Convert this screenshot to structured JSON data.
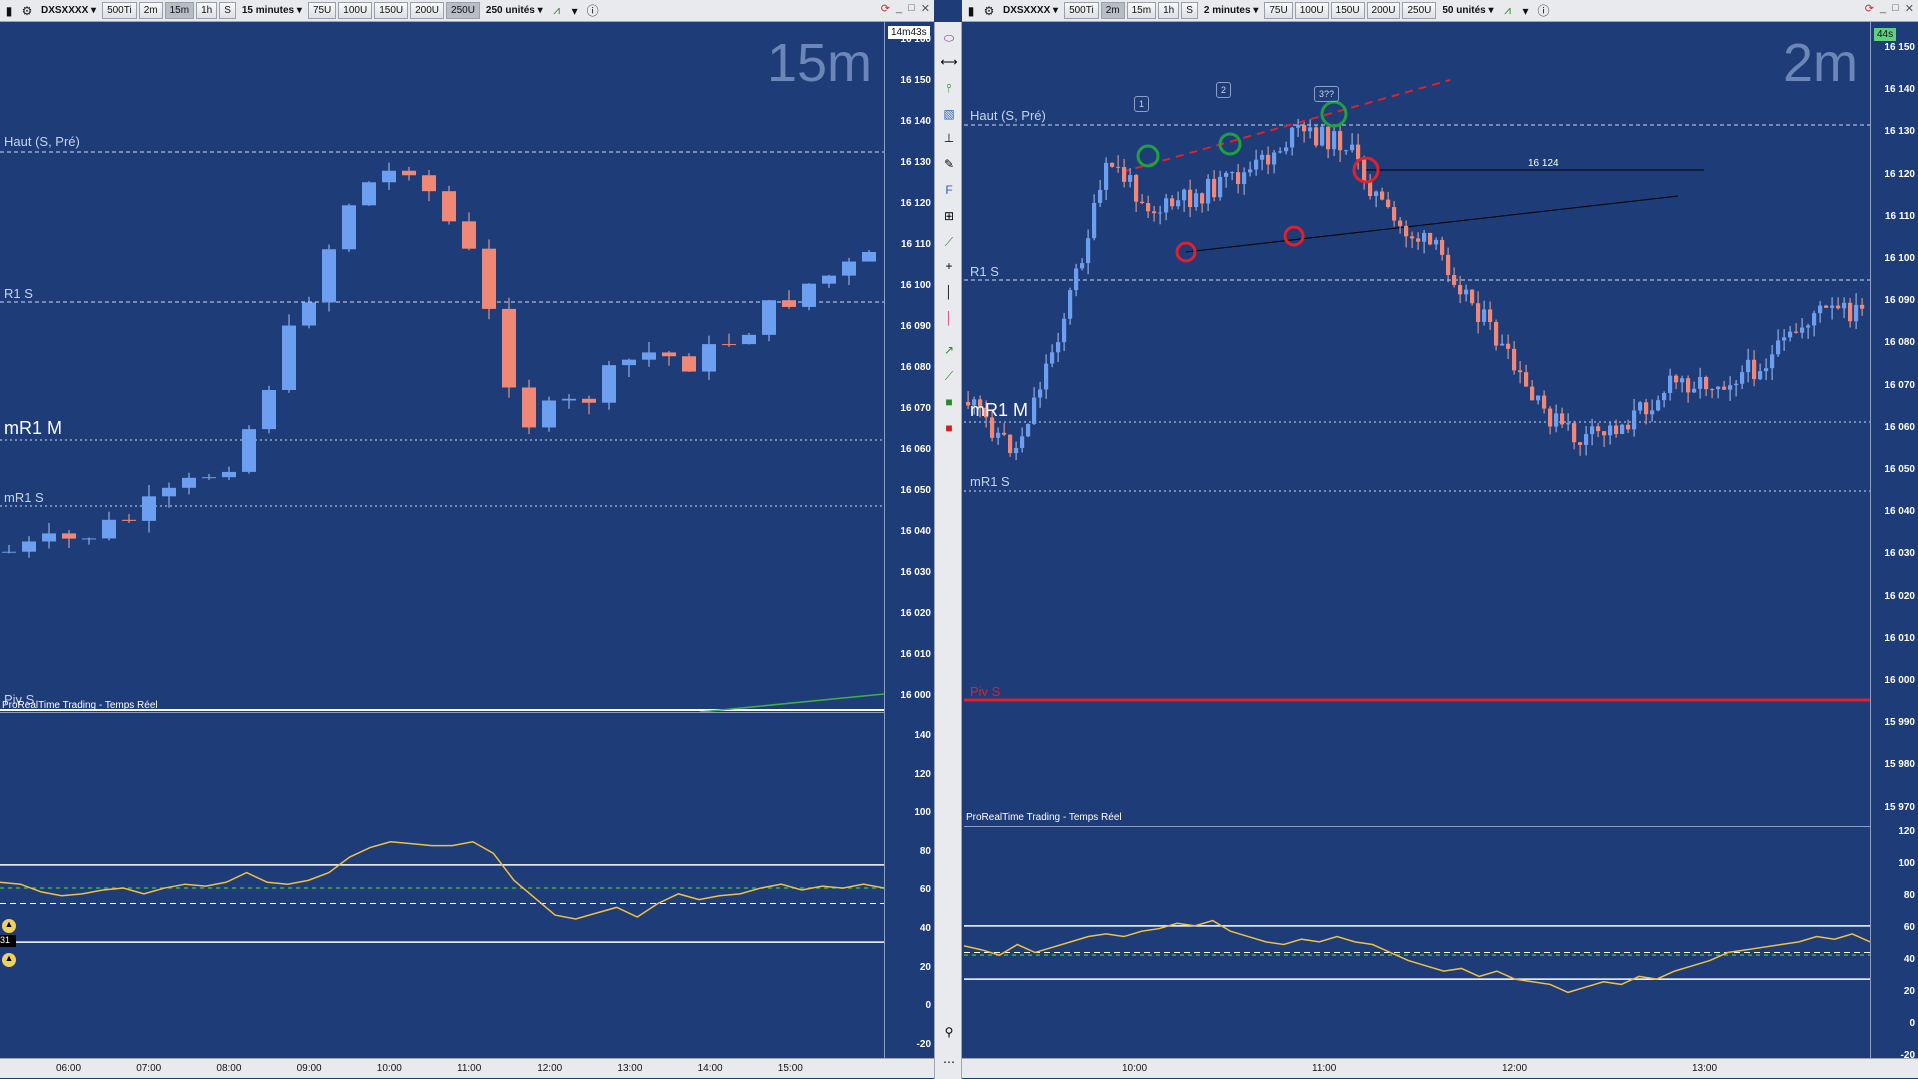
{
  "left": {
    "instrument": "DXSXXXX",
    "buttons": [
      "500Ti",
      "2m",
      "15m",
      "1h",
      "S"
    ],
    "active_button": "15m",
    "timeframe_select": "15 minutes",
    "unit_buttons": [
      "75U",
      "100U",
      "150U",
      "200U",
      "250U"
    ],
    "active_unit": "250U",
    "units_select": "250 unités",
    "big_label": "15m",
    "timer": "14m43s",
    "levels": {
      "haut": "Haut (S, Pré)",
      "r1s": "R1 S",
      "mr1m": "mR1 M",
      "mr1s": "mR1 S",
      "pivs": "Piv S"
    },
    "provider": "ProRealTime Trading - Temps Réel",
    "price_ticks": [
      "16 160",
      "16 150",
      "16 140",
      "16 130",
      "16 120",
      "16 110",
      "16 100",
      "16 090",
      "16 080",
      "16 070",
      "16 060",
      "16 050",
      "16 040",
      "16 030",
      "16 020",
      "16 010",
      "16 000"
    ],
    "osc_ticks": [
      "140",
      "120",
      "100",
      "80",
      "60",
      "40",
      "20",
      "0",
      "-20"
    ],
    "time_ticks": [
      "06:00",
      "07:00",
      "08:00",
      "09:00",
      "10:00",
      "11:00",
      "12:00",
      "13:00",
      "14:00",
      "15:00"
    ],
    "badge_value": "31"
  },
  "right": {
    "instrument": "DXSXXXX",
    "buttons": [
      "500Ti",
      "2m",
      "15m",
      "1h",
      "S"
    ],
    "active_button": "2m",
    "timeframe_select": "2 minutes",
    "unit_buttons": [
      "75U",
      "100U",
      "150U",
      "200U",
      "250U"
    ],
    "units_select": "50 unités",
    "big_label": "2m",
    "timer": "44s",
    "levels": {
      "haut": "Haut (S, Pré)",
      "r1s": "R1 S",
      "mr1m": "mR1 M",
      "mr1s": "mR1 S",
      "pivs": "Piv S"
    },
    "provider": "ProRealTime Trading - Temps Réel",
    "line_label": "16 124",
    "markers": [
      "1",
      "2",
      "3??"
    ],
    "price_ticks": [
      "16 150",
      "16 140",
      "16 130",
      "16 120",
      "16 110",
      "16 100",
      "16 090",
      "16 080",
      "16 070",
      "16 060",
      "16 050",
      "16 040",
      "16 030",
      "16 020",
      "16 010",
      "16 000",
      "15 990",
      "15 980",
      "15 970"
    ],
    "osc_ticks": [
      "120",
      "100",
      "80",
      "60",
      "40",
      "20",
      "0",
      "-20"
    ],
    "time_ticks": [
      "10:00",
      "11:00",
      "12:00",
      "13:00"
    ]
  },
  "colors": {
    "bg": "#1e3c78",
    "bull": "#6c9ff0",
    "bear": "#f08878",
    "pivot": "#e0202c",
    "osc": "#f0c040"
  }
}
